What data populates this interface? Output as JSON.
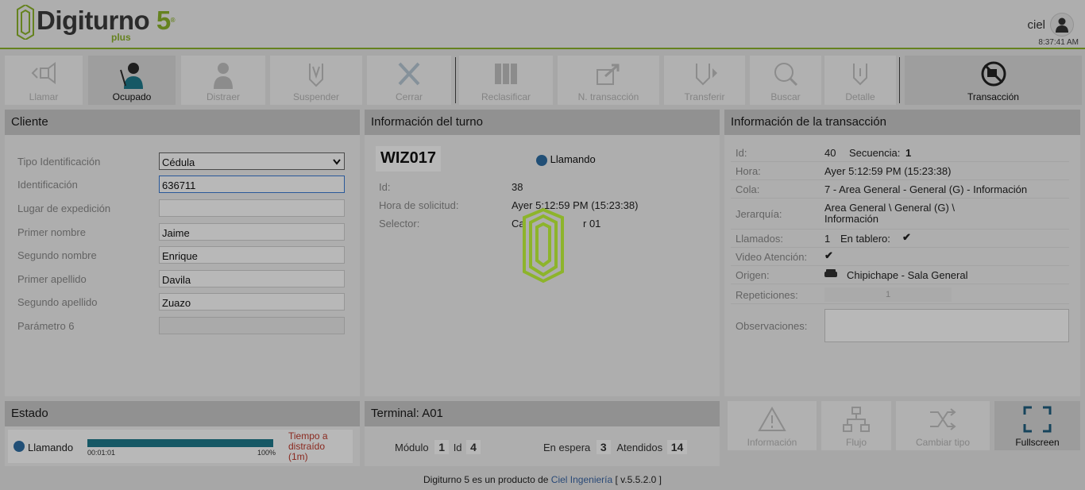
{
  "header": {
    "brand_name": "Digiturno",
    "brand_version": "5",
    "brand_reg": "®",
    "brand_suffix": "plus",
    "user_name": "ciel",
    "clock": "8:37:41 AM"
  },
  "toolbar": {
    "buttons": [
      {
        "label": "Llamar",
        "icon": "call-icon",
        "active": false
      },
      {
        "label": "Ocupado",
        "icon": "busy-agent-icon",
        "active": true
      },
      {
        "label": "Distraer",
        "icon": "person-icon",
        "active": false
      },
      {
        "label": "Suspender",
        "icon": "suspend-icon",
        "active": false
      },
      {
        "label": "Cerrar",
        "icon": "close-icon",
        "active": false
      },
      {
        "label": "Reclasificar",
        "icon": "binders-icon",
        "active": false
      },
      {
        "label": "N. transacción",
        "icon": "new-transaction-icon",
        "active": false
      },
      {
        "label": "Transferir",
        "icon": "transfer-icon",
        "active": false
      },
      {
        "label": "Buscar",
        "icon": "search-icon",
        "active": false
      },
      {
        "label": "Detalle",
        "icon": "detail-icon",
        "active": false
      },
      {
        "label": "Transacción",
        "icon": "no-transaction-icon",
        "active": true
      }
    ]
  },
  "cliente": {
    "title": "Cliente",
    "fields": [
      {
        "label": "Tipo Identificación",
        "value": "Cédula"
      },
      {
        "label": "Identificación",
        "value": "636711"
      },
      {
        "label": "Lugar de expedición",
        "value": ""
      },
      {
        "label": "Primer nombre",
        "value": "Jaime"
      },
      {
        "label": "Segundo nombre",
        "value": "Enrique"
      },
      {
        "label": "Primer apellido",
        "value": "Davila"
      },
      {
        "label": "Segundo apellido",
        "value": "Zuazo"
      },
      {
        "label": "Parámetro 6",
        "value": ""
      }
    ]
  },
  "turno": {
    "title": "Información del turno",
    "code": "WIZ017",
    "status": "Llamando",
    "id_label": "Id:",
    "id_value": "38",
    "hora_label": "Hora de solicitud:",
    "hora_value": "Ayer 5:12:59 PM (15:23:38)",
    "selector_label": "Selector:",
    "selector_value_start": "Ca",
    "selector_value_end": "r 01"
  },
  "transaccion": {
    "title": "Información de la transacción",
    "id_label": "Id:",
    "id_value": "40",
    "secuencia_label": "Secuencia:",
    "secuencia_value": "1",
    "hora_label": "Hora:",
    "hora_value": "Ayer 5:12:59 PM (15:23:38)",
    "cola_label": "Cola:",
    "cola_value": "7 - Area General - General (G) - Información",
    "jerarquia_label": "Jerarquía:",
    "jerarquia_line1": "Area General \\ General (G) \\",
    "jerarquia_line2": "Información",
    "llamados_label": "Llamados:",
    "llamados_value": "1",
    "tablero_label": "En tablero:",
    "video_label": "Video Atención:",
    "origen_label": "Origen:",
    "origen_value": "Chipichape - Sala General",
    "repeticiones_label": "Repeticiones:",
    "repeticiones_value": "1",
    "observaciones_label": "Observaciones:",
    "observaciones_value": ""
  },
  "estado": {
    "title": "Estado",
    "status": "Llamando",
    "progress": 1.0,
    "elapsed": "00:01:01",
    "percent": "100%",
    "distracted_line1": "Tiempo a",
    "distracted_line2": "distraído",
    "distracted_line3": "(1m)"
  },
  "terminal": {
    "title": "Terminal: A01",
    "modulo_label": "Módulo",
    "modulo_value": "1",
    "id_label": "Id",
    "id_value": "4",
    "espera_label": "En espera",
    "espera_value": "3",
    "atendidos_label": "Atendidos",
    "atendidos_value": "14"
  },
  "actions": [
    {
      "label": "Información",
      "icon": "warning-icon",
      "active": false
    },
    {
      "label": "Flujo",
      "icon": "flow-icon",
      "active": false
    },
    {
      "label": "Cambiar tipo",
      "icon": "shuffle-icon",
      "active": false
    },
    {
      "label": "Fullscreen",
      "icon": "fullscreen-icon",
      "active": true
    }
  ],
  "footer": {
    "prefix": "Digiturno 5 es un producto de",
    "company": "Ciel Ingeniería",
    "version": "[ v.5.5.2.0 ]"
  },
  "colors": {
    "brand_green": "#8db42b",
    "status_blue": "#2e6ea4",
    "alert_red": "#c0392b"
  }
}
